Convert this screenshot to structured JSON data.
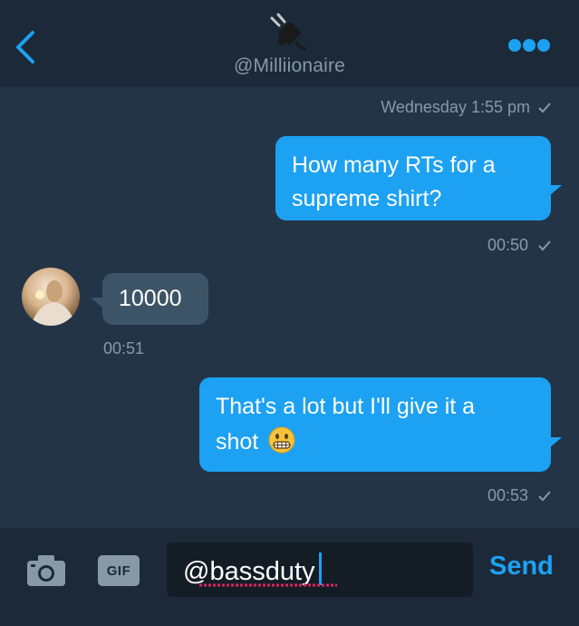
{
  "header": {
    "handle": "@Milliionaire",
    "contact_icon": "electric-plug-icon",
    "back_icon": "chevron-left-icon",
    "more_icon": "more-dots-icon"
  },
  "conversation": {
    "date_header": "Wednesday 1:55 pm",
    "messages": [
      {
        "direction": "outgoing",
        "lines": [
          "How many RTs for a",
          "supreme shirt?"
        ],
        "time": "00:50"
      },
      {
        "direction": "incoming",
        "text": "10000",
        "time": "00:51"
      },
      {
        "direction": "outgoing",
        "lines": [
          "That's a lot but I'll give it a",
          "shot"
        ],
        "emoji": "grimacing-face-icon",
        "time": "00:53"
      }
    ]
  },
  "composer": {
    "camera_icon": "camera-icon",
    "gif_label": "GIF",
    "input_value": "@bassduty",
    "send_label": "Send"
  },
  "colors": {
    "background": "#243447",
    "header_bg": "#1c2938",
    "accent": "#1da1f2",
    "incoming_bubble": "#3d5466",
    "muted_text": "#8899a6",
    "input_bg": "#141d26"
  }
}
